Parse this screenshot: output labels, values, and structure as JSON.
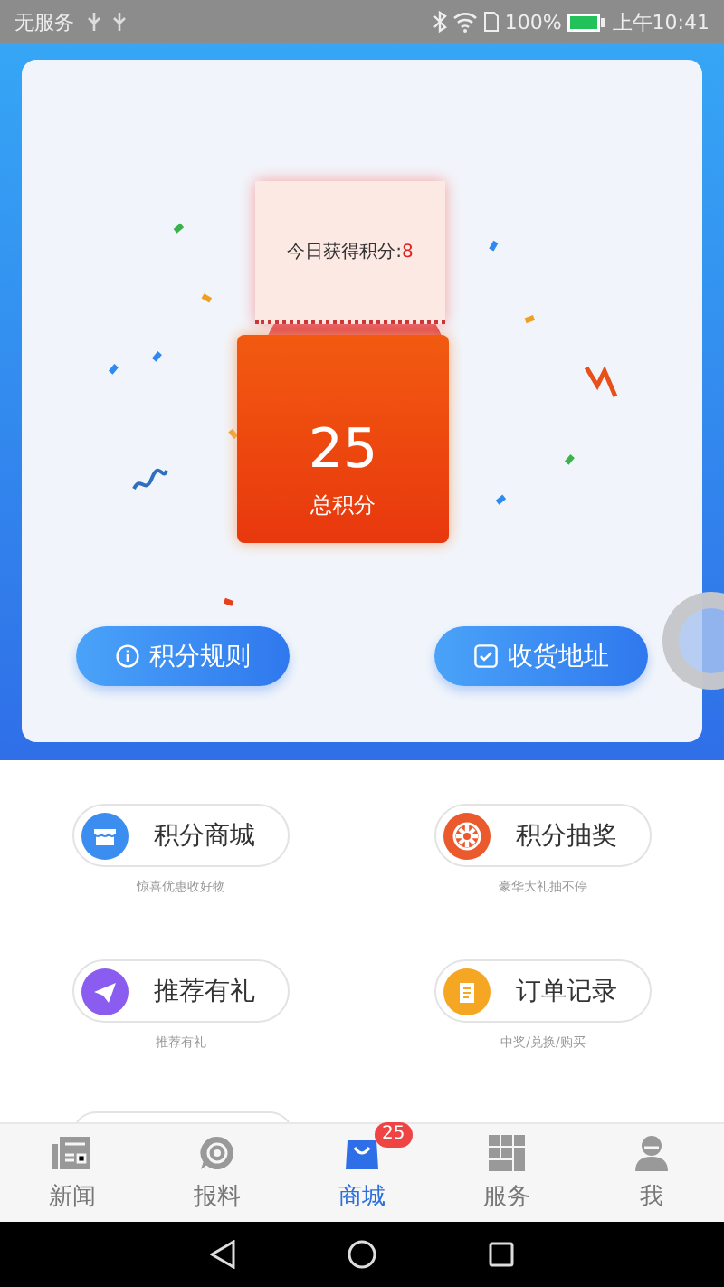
{
  "status_bar": {
    "carrier": "无服务",
    "battery": "100%",
    "time": "上午10:41"
  },
  "points": {
    "today_label": "今日获得积分:",
    "today_value": "8",
    "total": "25",
    "total_label": "总积分"
  },
  "actions": [
    {
      "label": "积分规则",
      "kind": "info"
    },
    {
      "label": "收货地址",
      "kind": "check"
    }
  ],
  "features": [
    {
      "label": "积分商城",
      "subtitle": "惊喜优惠收好物",
      "kind": "store",
      "color": "#3b8ef0"
    },
    {
      "label": "积分抽奖",
      "subtitle": "豪华大礼抽不停",
      "kind": "wheel",
      "color": "#ea5a2c"
    },
    {
      "label": "推荐有礼",
      "subtitle": "推荐有礼",
      "kind": "plane",
      "color": "#8a5cf0"
    },
    {
      "label": "订单记录",
      "subtitle": "中奖/兑换/购买",
      "kind": "note",
      "color": "#f5a623"
    }
  ],
  "tabs": [
    {
      "label": "新闻",
      "kind": "news",
      "selected": false
    },
    {
      "label": "报料",
      "kind": "report",
      "selected": false
    },
    {
      "label": "商城",
      "kind": "shop",
      "selected": true,
      "badge": "25"
    },
    {
      "label": "服务",
      "kind": "grid",
      "selected": false
    },
    {
      "label": "我",
      "kind": "user",
      "selected": false
    }
  ]
}
